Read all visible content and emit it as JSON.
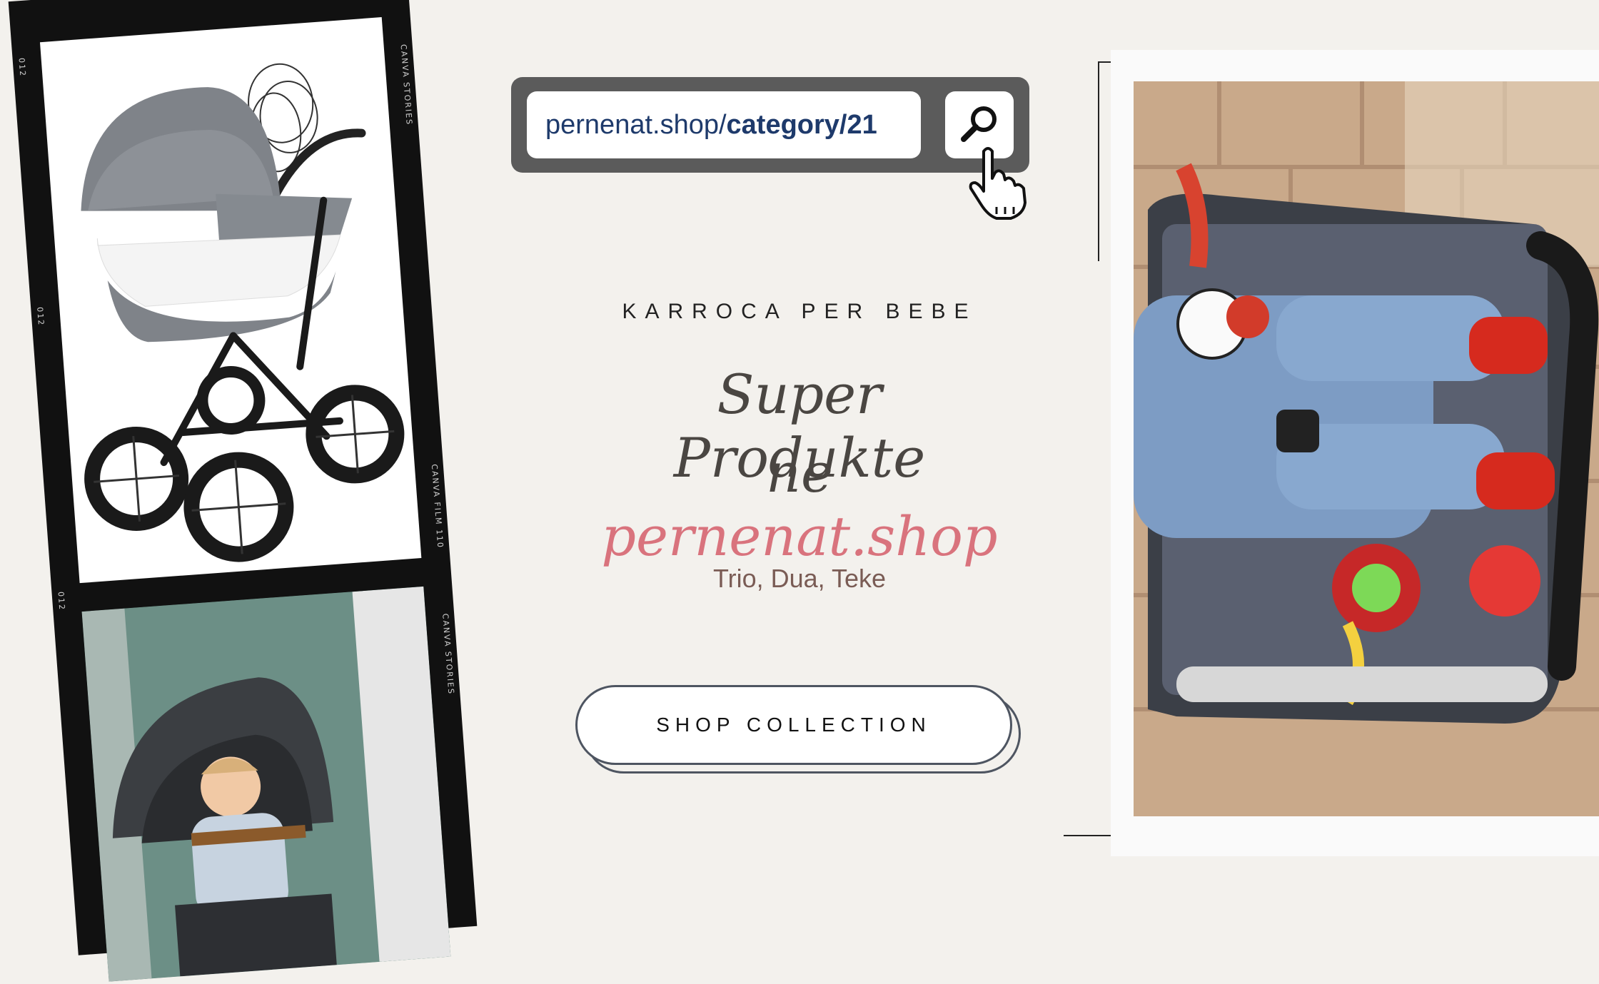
{
  "search": {
    "url_prefix": "pernenat.shop/",
    "url_path": "category/21"
  },
  "headline": {
    "kicker": "KARROCA PER BEBE",
    "line1": "Super Produkte",
    "line2_prefix": "ne ",
    "line2_brand": "pernenat.shop"
  },
  "types": "Trio, Dua, Teke",
  "cta": {
    "label": "SHOP COLLECTION"
  },
  "film": {
    "edge_top": "CANVA STORIES",
    "edge_mid": "CANVA FILM 110",
    "edge_bottom": "CANVA STORIES",
    "frame_no_1": "012",
    "frame_no_2": "012",
    "frame_no_3": "012"
  },
  "colors": {
    "background": "#f3f1ed",
    "search_bar": "#5b5b5b",
    "url_text": "#1e3a6b",
    "brand_script": "#d9737d",
    "types_text": "#7a5c55"
  },
  "icons": [
    "search-magnifier-icon",
    "pointer-hand-icon"
  ]
}
